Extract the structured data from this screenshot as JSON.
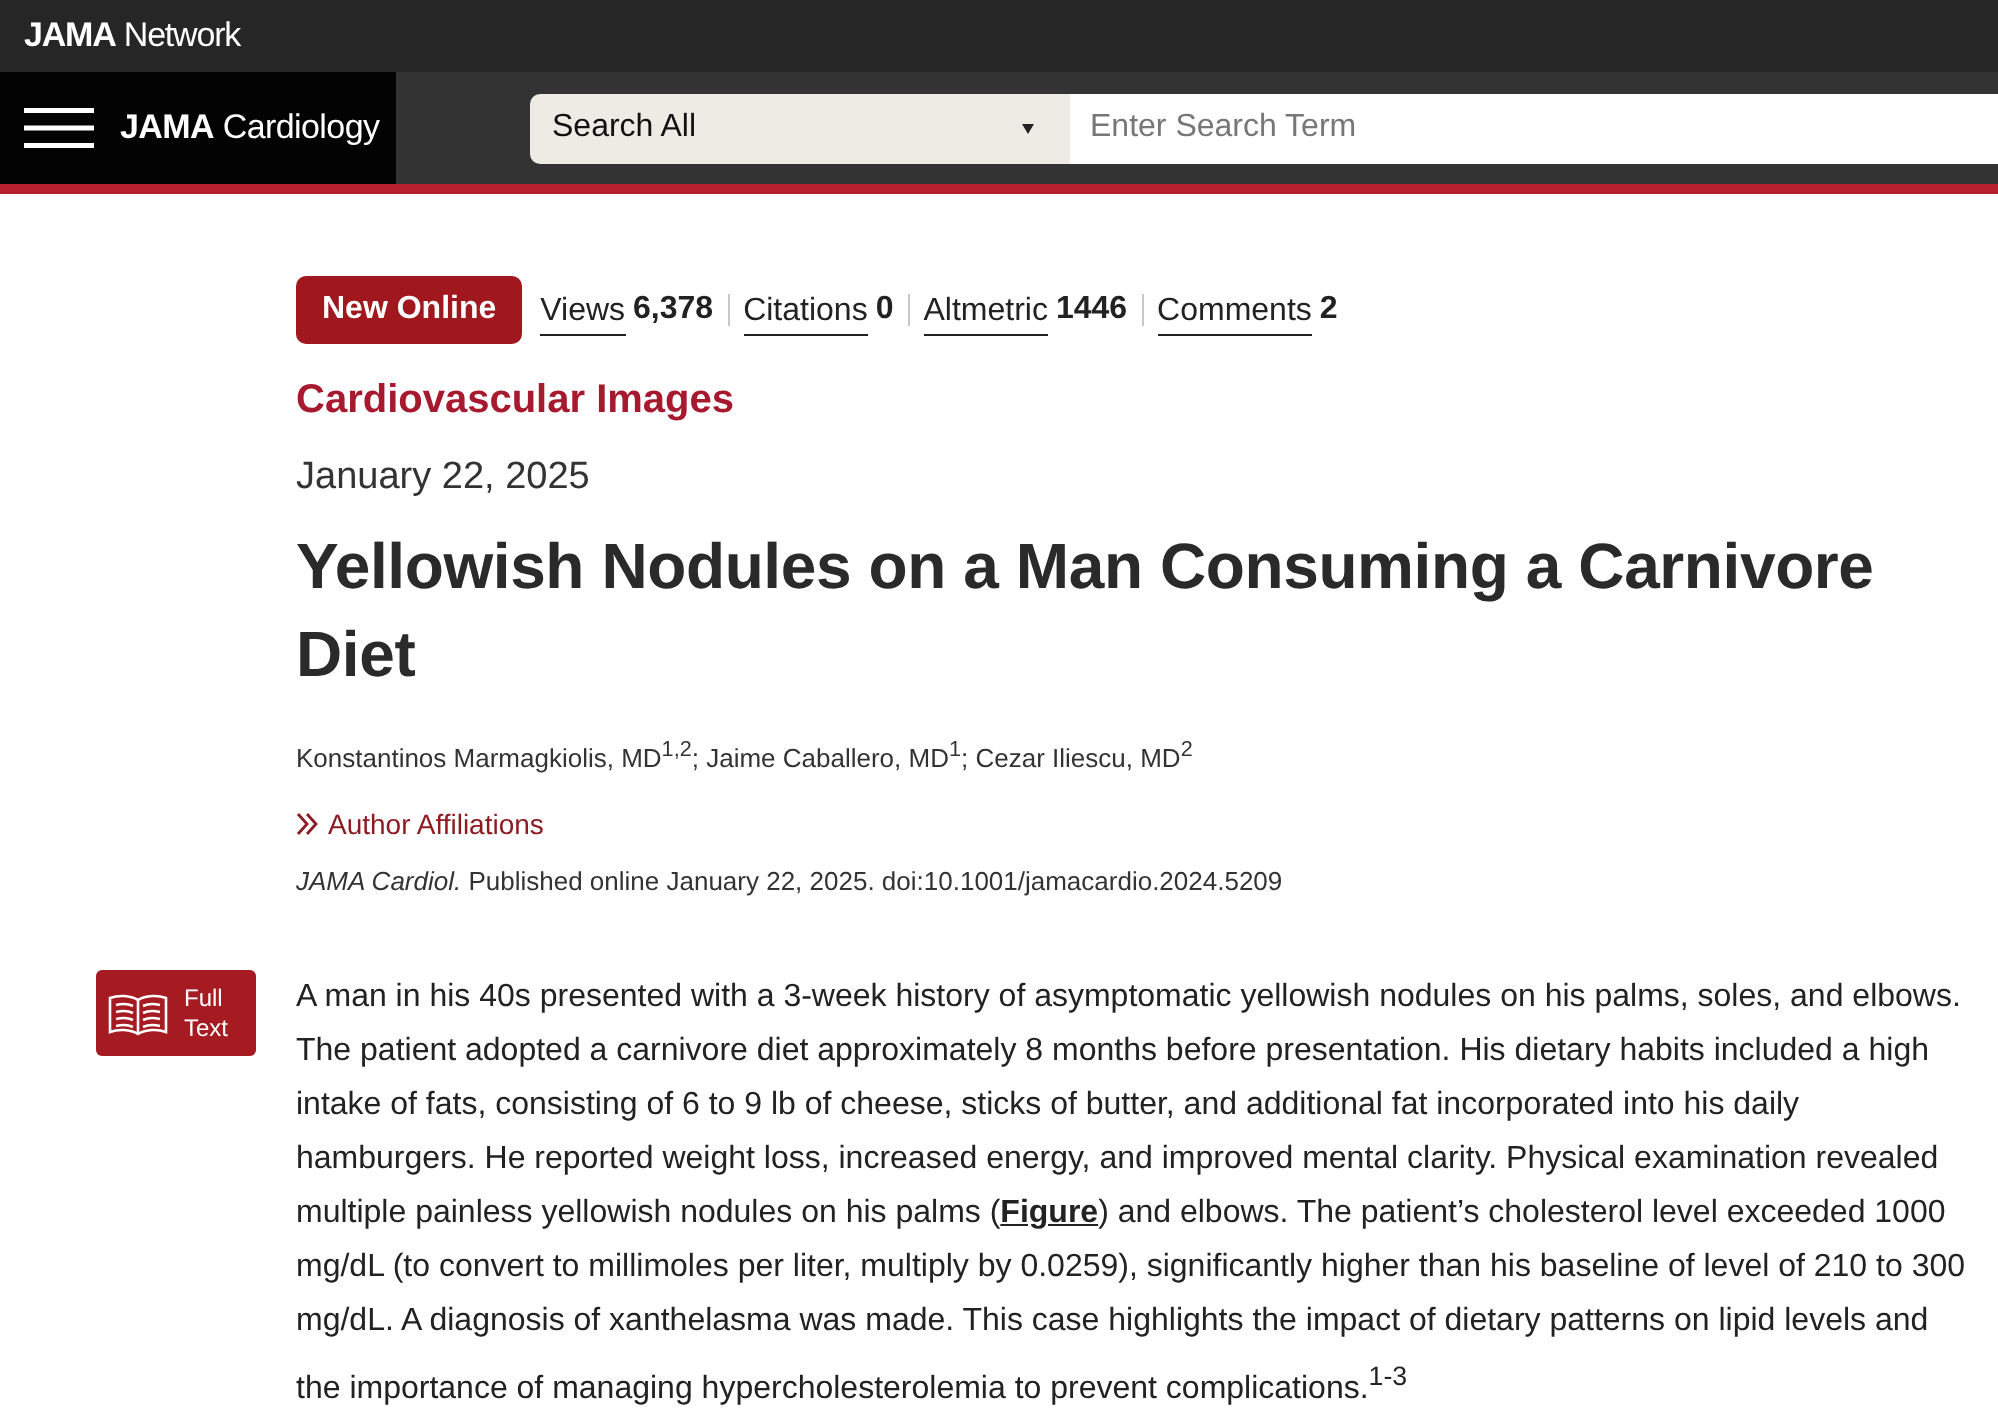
{
  "header": {
    "network_logo": "**JAMA** Network"
  },
  "navbar": {
    "journal": "**JAMA** Cardiology",
    "search": {
      "scope": "Search All",
      "placeholder": "Enter Search Term"
    }
  },
  "article": {
    "badge": "New Online",
    "metrics": [
      {
        "label": "Views",
        "value": "6,378"
      },
      {
        "label": "Citations",
        "value": "0"
      },
      {
        "label": "Altmetric",
        "value": "1446"
      },
      {
        "label": "Comments",
        "value": "2"
      }
    ],
    "section": "Cardiovascular Images",
    "date": "January 22, 2025",
    "title": "Yellowish Nodules on a Man Consuming a Carnivore Diet",
    "authors": "Konstantinos Marmagkiolis, MD$^{1,2}$; Jaime Caballero, MD$^{1}$; Cezar Iliescu, MD$^{2}$",
    "affiliations_link": "Author Affiliations",
    "citation": "*JAMA Cardiol.* Published online January 22, 2025. doi:10.1001/jamacardio.2024.5209",
    "full_text_button": "Full Text",
    "body": {
      "before": "A man in his 40s presented with a 3-week history of asymptomatic yellowish nodules on his palms, soles, and elbows. The patient adopted a carnivore diet approximately 8 months before presentation. His dietary habits included a high intake of fats, consisting of 6 to 9 lb of cheese, sticks of butter, and additional fat incorporated into his daily hamburgers. He reported weight loss, increased energy, and improved mental clarity. Physical examination revealed multiple painless yellowish nodules on his palms (",
      "link": "Figure",
      "after": ") and elbows. The patient’s cholesterol level exceeded 1000 mg/dL (to convert to millimoles per liter, multiply by 0.0259), significantly higher than his baseline of level of 210 to 300 mg/dL. A diagnosis of xanthelasma was made. This case highlights the impact of dietary patterns on lipid levels and the importance of managing hypercholesterolemia to prevent complications.$^{1-3}$"
    }
  }
}
